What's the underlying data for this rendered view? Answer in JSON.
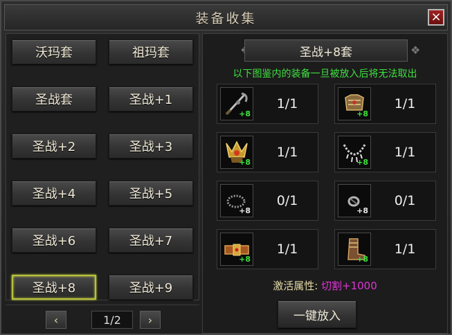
{
  "window": {
    "title": "装备收集",
    "close_icon": "×"
  },
  "sets": [
    {
      "label": "沃玛套",
      "name": "set-button-woma"
    },
    {
      "label": "祖玛套",
      "name": "set-button-zuma"
    },
    {
      "label": "圣战套",
      "name": "set-button-shengzhan"
    },
    {
      "label": "圣战+1",
      "name": "set-button-shengzhan-1"
    },
    {
      "label": "圣战+2",
      "name": "set-button-shengzhan-2"
    },
    {
      "label": "圣战+3",
      "name": "set-button-shengzhan-3"
    },
    {
      "label": "圣战+4",
      "name": "set-button-shengzhan-4"
    },
    {
      "label": "圣战+5",
      "name": "set-button-shengzhan-5"
    },
    {
      "label": "圣战+6",
      "name": "set-button-shengzhan-6"
    },
    {
      "label": "圣战+7",
      "name": "set-button-shengzhan-7"
    },
    {
      "label": "圣战+8",
      "name": "set-button-shengzhan-8",
      "selected": true
    },
    {
      "label": "圣战+9",
      "name": "set-button-shengzhan-9"
    }
  ],
  "pager": {
    "page": "1/2",
    "prev_icon": "‹",
    "next_icon": "›"
  },
  "detail": {
    "set_title": "圣战+8套",
    "warning": "以下图鉴内的装备一旦被放入后将无法取出",
    "items": [
      {
        "name": "weapon",
        "icon": "weapon-icon",
        "count": "1/1",
        "enhance": "+8",
        "complete": true
      },
      {
        "name": "armor",
        "icon": "armor-icon",
        "count": "1/1",
        "enhance": "+8",
        "complete": true
      },
      {
        "name": "helmet",
        "icon": "helmet-icon",
        "count": "1/1",
        "enhance": "+8",
        "complete": true
      },
      {
        "name": "necklace",
        "icon": "necklace-icon",
        "count": "1/1",
        "enhance": "+8",
        "complete": true
      },
      {
        "name": "bracelet",
        "icon": "bracelet-icon",
        "count": "0/1",
        "enhance": "+8",
        "complete": false
      },
      {
        "name": "ring",
        "icon": "ring-icon",
        "count": "0/1",
        "enhance": "+8",
        "complete": false
      },
      {
        "name": "belt",
        "icon": "belt-icon",
        "count": "1/1",
        "enhance": "+8",
        "complete": true
      },
      {
        "name": "boots",
        "icon": "boots-icon",
        "count": "1/1",
        "enhance": "+8",
        "complete": true
      }
    ],
    "attr_label": "激活属性: ",
    "attr_value": "切割+1000",
    "put_all_label": "一键放入"
  },
  "colors": {
    "accent_green": "#3fe03f",
    "attr_magenta": "#e033d6",
    "selected_border": "#b7c23a"
  }
}
